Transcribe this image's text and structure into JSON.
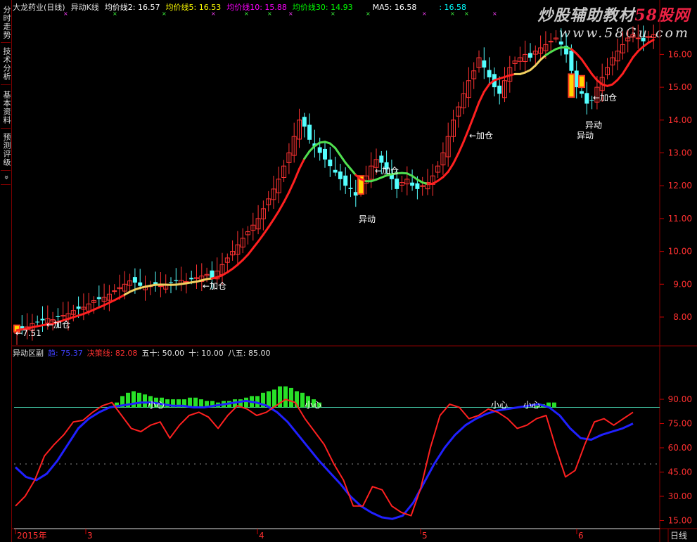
{
  "sidebar": {
    "tabs": [
      "分时走势",
      "技术分析",
      "基本资料",
      "预测评级",
      "»"
    ]
  },
  "header": {
    "stock": "大龙药业(日线)",
    "indicator": "异动K线",
    "ma2": "均价线2: 16.57",
    "ma5": "均价线5: 16.53",
    "ma10": "均价线10: 15.88",
    "ma30": "均价线30: 14.93",
    "ma5b": "MA5: 16.58",
    "ma5b_val": ": 16.58",
    "colors": {
      "stock": "#e0e0e0",
      "ma2": "#ffffff",
      "ma5": "#ffff00",
      "ma10": "#ff00ff",
      "ma30": "#00ff00",
      "ma5b": "#ffffff",
      "ma5b_val": "#00ffff"
    }
  },
  "watermark": {
    "title_a": "炒股辅助教材",
    "title_b": "58股网",
    "url": "www.58Gu.com"
  },
  "price_axis": {
    "ticks": [
      "16.00",
      "15.00",
      "14.00",
      "13.00",
      "12.00",
      "11.00",
      "10.00",
      "9.00",
      "8.00"
    ],
    "min_label": "7.51"
  },
  "annotations": {
    "add_position": "←加仓",
    "abnormal": "异动",
    "caution": "小心"
  },
  "indicator_panel": {
    "name": "异动区副",
    "line1": "趋: 75.37",
    "line2": "决策线: 82.08",
    "params": [
      "五十: 50.00",
      "十: 10.00",
      "八五: 85.00"
    ],
    "axis_ticks": [
      "90.00",
      "75.00",
      "60.00",
      "45.00",
      "30.00",
      "15.00"
    ]
  },
  "date_axis": {
    "labels": [
      "2015年",
      "3",
      "4",
      "5",
      "6"
    ],
    "period": "日线"
  },
  "colors": {
    "background": "#000000",
    "up_candle": "#ff3232",
    "down_candle": "#54ffff",
    "ma_line": "#ff2020",
    "ma_green": "#50e050",
    "ma_yellow": "#f0d060",
    "trend_line": "#2020ff",
    "decision_line": "#ff2020",
    "bars": "#28e028",
    "level85": "#40c0a0",
    "grid": "#8b0000"
  }
}
